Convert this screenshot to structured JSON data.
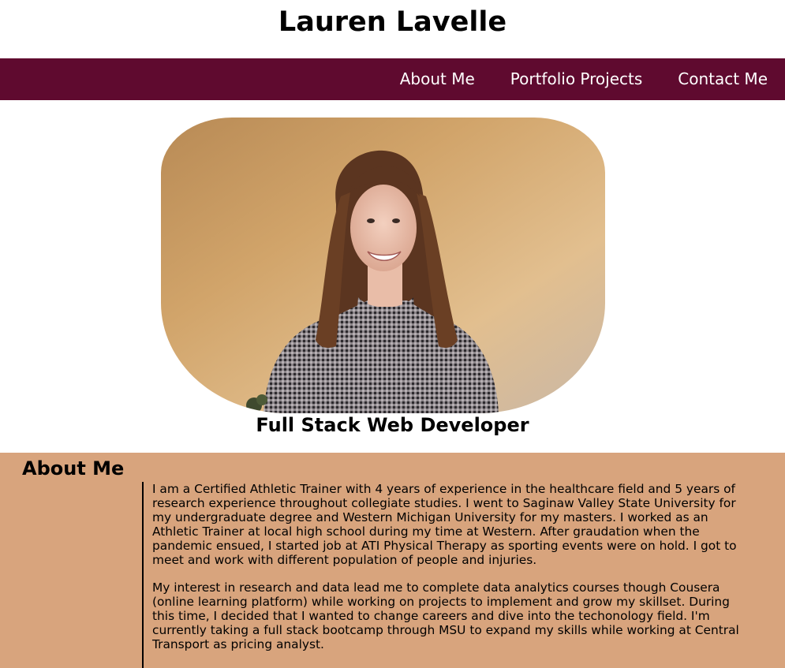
{
  "header": {
    "title": "Lauren Lavelle"
  },
  "nav": {
    "items": [
      {
        "label": "About Me"
      },
      {
        "label": "Portfolio Projects"
      },
      {
        "label": "Contact Me"
      }
    ]
  },
  "hero": {
    "subtitle": "Full Stack Web Developer"
  },
  "about": {
    "heading": "About Me",
    "paragraphs": [
      "I am a Certified Athletic Trainer with 4 years of experience in the healthcare field and 5 years of research experience throughout collegiate studies. I went to Saginaw Valley State University for my undergraduate degree and Western Michigan University for my masters. I worked as an Athletic Trainer at local high school during my time at Western. After graudation when the pandemic ensued, I started job at ATI Physical Therapy as sporting events were on hold. I got to meet and work with different population of people and injuries.",
      "My interest in research and data lead me to complete data analytics courses though Cousera (online learning platform) while working on projects to implement and grow my skillset. During this time, I decided that I wanted to change careers and dive into the techonology field. I'm currently taking a full stack bootcamp through MSU to expand my skills while working at Central Transport as pricing analyst."
    ]
  },
  "colors": {
    "nav_background": "#5f0a2f",
    "about_background": "#d8a47d",
    "nav_text": "#ffffff"
  }
}
